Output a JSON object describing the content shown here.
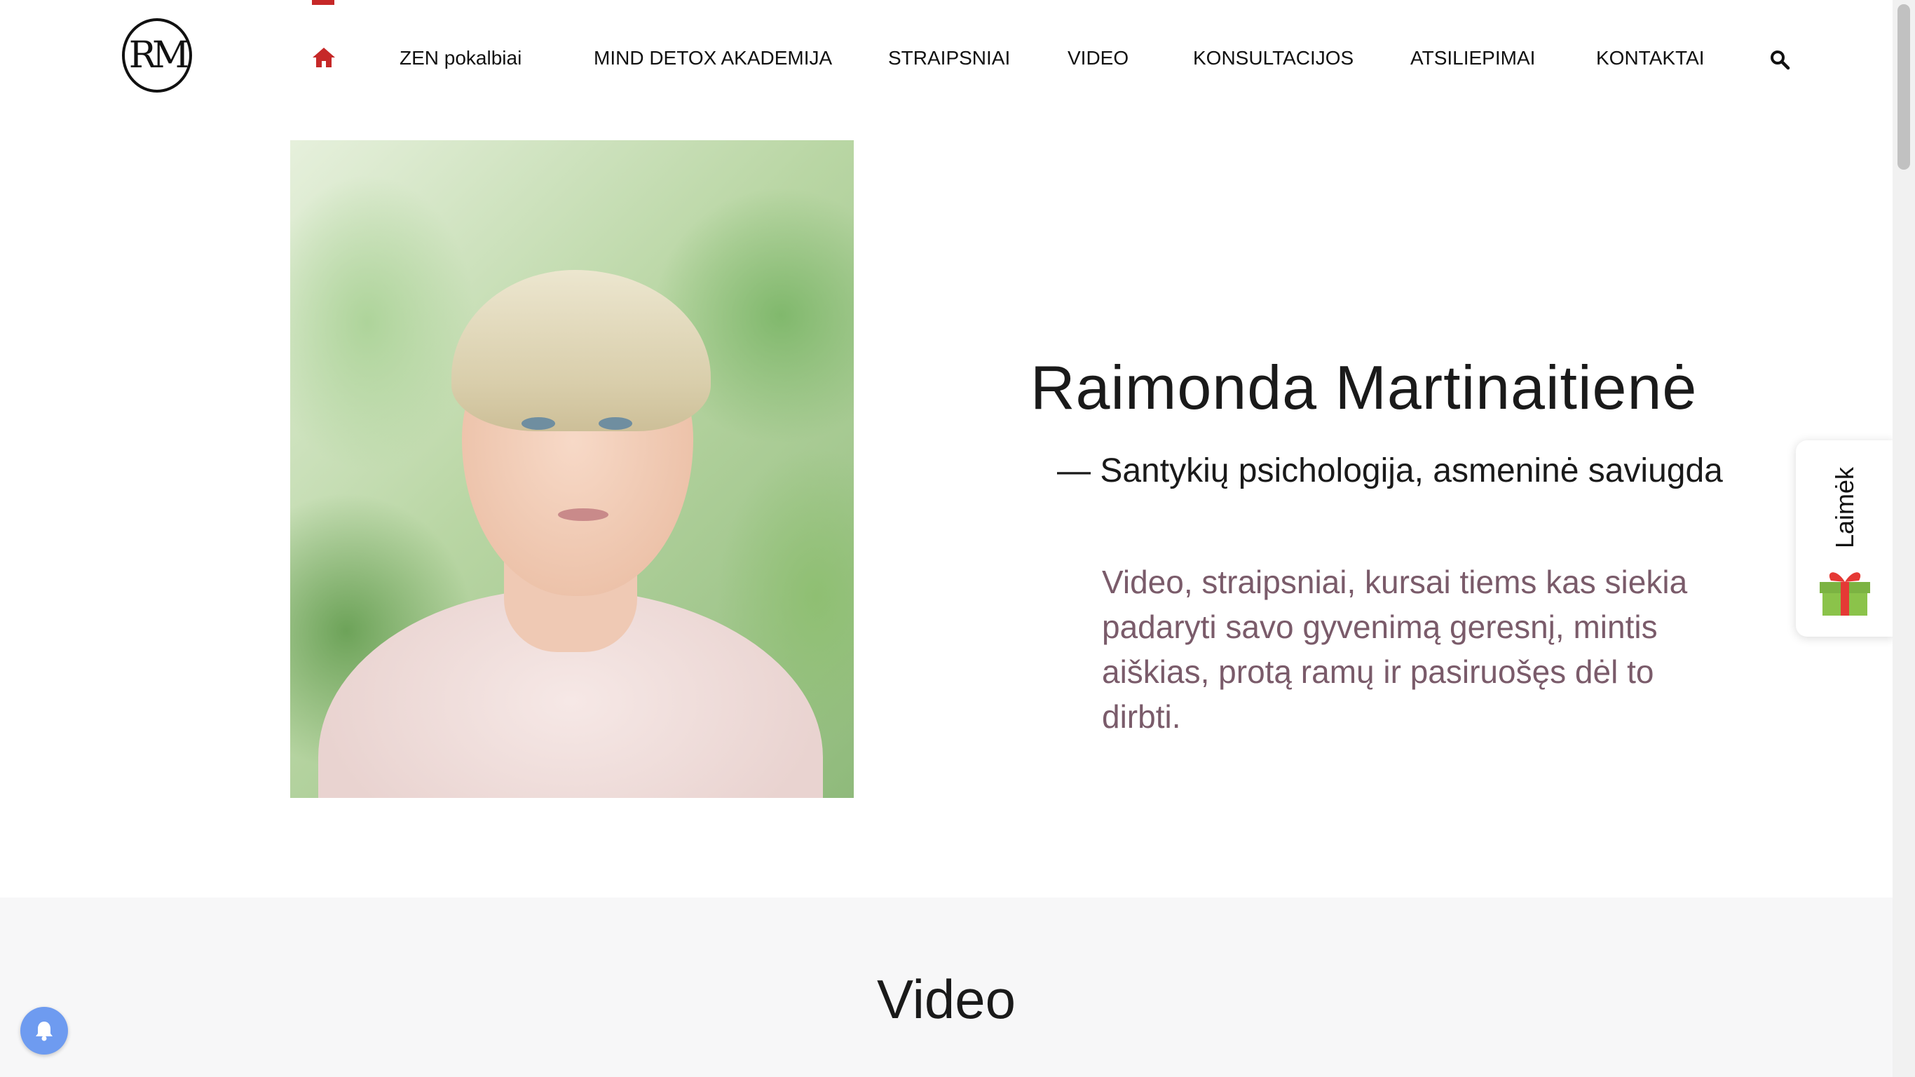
{
  "nav": {
    "home_icon": "home-icon",
    "items": [
      {
        "label": "ZEN pokalbiai"
      },
      {
        "label": "MIND DETOX AKADEMIJA"
      },
      {
        "label": "STRAIPSNIAI"
      },
      {
        "label": "VIDEO"
      },
      {
        "label": "KONSULTACIJOS"
      },
      {
        "label": "ATSILIEPIMAI"
      },
      {
        "label": "KONTAKTAI"
      }
    ],
    "search_icon": "search-icon",
    "accent_color": "#c62828"
  },
  "logo": {
    "text": "RM"
  },
  "hero": {
    "name": "Raimonda Martinaitienė",
    "tagline": "— Santykių psichologija, asmeninė saviugda",
    "description": "Video, straipsniai, kursai tiems kas siekia padaryti savo gyvenimą geresnį, mintis aiškias, protą ramų ir pasiruošęs dėl to dirbti.",
    "description_color": "#7a5b6a"
  },
  "gift_widget": {
    "label": "Laimėk",
    "icon": "gift-icon"
  },
  "video_section": {
    "title": "Video"
  },
  "notification": {
    "icon": "bell-icon",
    "color": "#6e9bf0"
  }
}
